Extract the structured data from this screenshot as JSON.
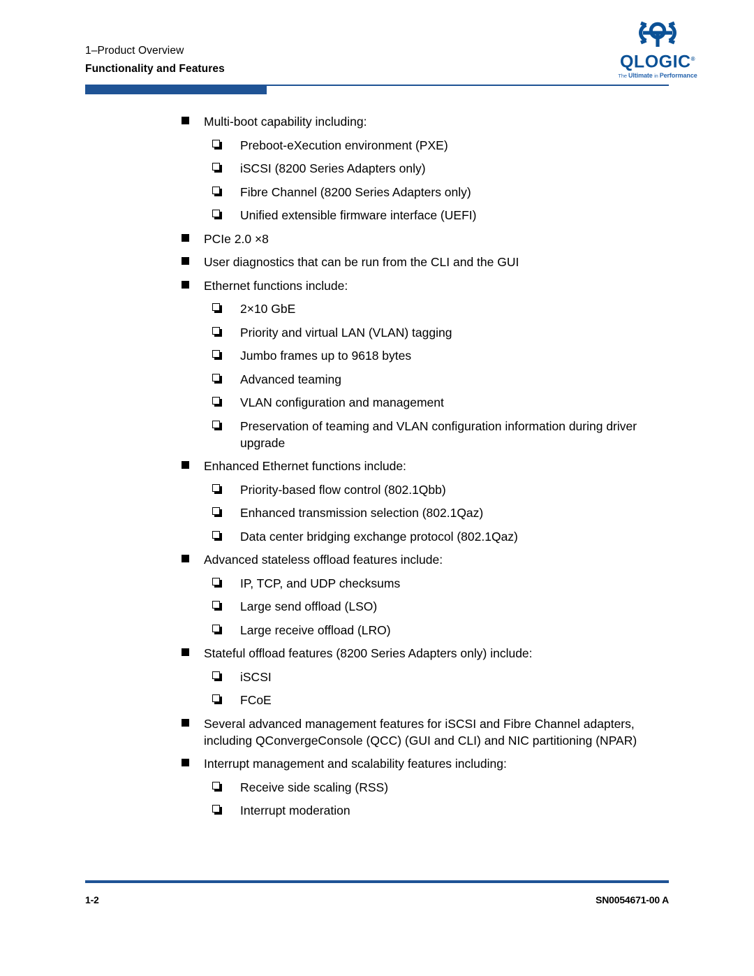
{
  "header": {
    "chapter_line": "1–Product Overview",
    "section_line": "Functionality and Features"
  },
  "logo": {
    "mark_name": "qlogic-mark-icon",
    "wordmark": "QLOGIC",
    "registered": "®",
    "tagline_prefix": "The ",
    "tagline_strong1": "Ultimate ",
    "tagline_in": "in ",
    "tagline_strong2": "Performance",
    "brand_color": "#0B5196",
    "accent_color": "#1F5395"
  },
  "footer": {
    "page_number": "1-2",
    "document_number": "SN0054671-00  A"
  },
  "content": {
    "items": [
      {
        "level": 1,
        "text": "Multi-boot capability including:"
      },
      {
        "level": 2,
        "text": "Preboot-eXecution environment (PXE)"
      },
      {
        "level": 2,
        "text": "iSCSI (8200 Series Adapters only)"
      },
      {
        "level": 2,
        "text": "Fibre Channel (8200 Series Adapters only)"
      },
      {
        "level": 2,
        "text": "Unified extensible firmware interface (UEFI)"
      },
      {
        "level": 1,
        "text": "PCIe 2.0 ×8"
      },
      {
        "level": 1,
        "text": "User diagnostics that can be run from the CLI and the GUI"
      },
      {
        "level": 1,
        "text": "Ethernet functions include:"
      },
      {
        "level": 2,
        "text": "2×10 GbE"
      },
      {
        "level": 2,
        "text": "Priority and virtual LAN (VLAN) tagging"
      },
      {
        "level": 2,
        "text": "Jumbo frames up to 9618 bytes"
      },
      {
        "level": 2,
        "text": "Advanced teaming"
      },
      {
        "level": 2,
        "text": "VLAN configuration and management"
      },
      {
        "level": 2,
        "text": "Preservation of teaming and VLAN configuration information during driver upgrade"
      },
      {
        "level": 1,
        "text": "Enhanced Ethernet functions include:"
      },
      {
        "level": 2,
        "text": "Priority-based flow control (802.1Qbb)"
      },
      {
        "level": 2,
        "text": "Enhanced transmission selection (802.1Qaz)"
      },
      {
        "level": 2,
        "text": "Data center bridging exchange protocol (802.1Qaz)"
      },
      {
        "level": 1,
        "text": "Advanced stateless offload features include:"
      },
      {
        "level": 2,
        "text": "IP, TCP, and UDP checksums"
      },
      {
        "level": 2,
        "text": "Large send offload (LSO)"
      },
      {
        "level": 2,
        "text": "Large receive offload (LRO)"
      },
      {
        "level": 1,
        "text": "Stateful offload features (8200 Series Adapters only) include:"
      },
      {
        "level": 2,
        "text": "iSCSI"
      },
      {
        "level": 2,
        "text": "FCoE"
      },
      {
        "level": 1,
        "text": "Several advanced management features for iSCSI and Fibre Channel adapters, including QConvergeConsole (QCC) (GUI and CLI) and NIC partitioning (NPAR)"
      },
      {
        "level": 1,
        "text": "Interrupt management and scalability features including:"
      },
      {
        "level": 2,
        "text": "Receive side scaling (RSS)"
      },
      {
        "level": 2,
        "text": "Interrupt moderation"
      }
    ]
  }
}
